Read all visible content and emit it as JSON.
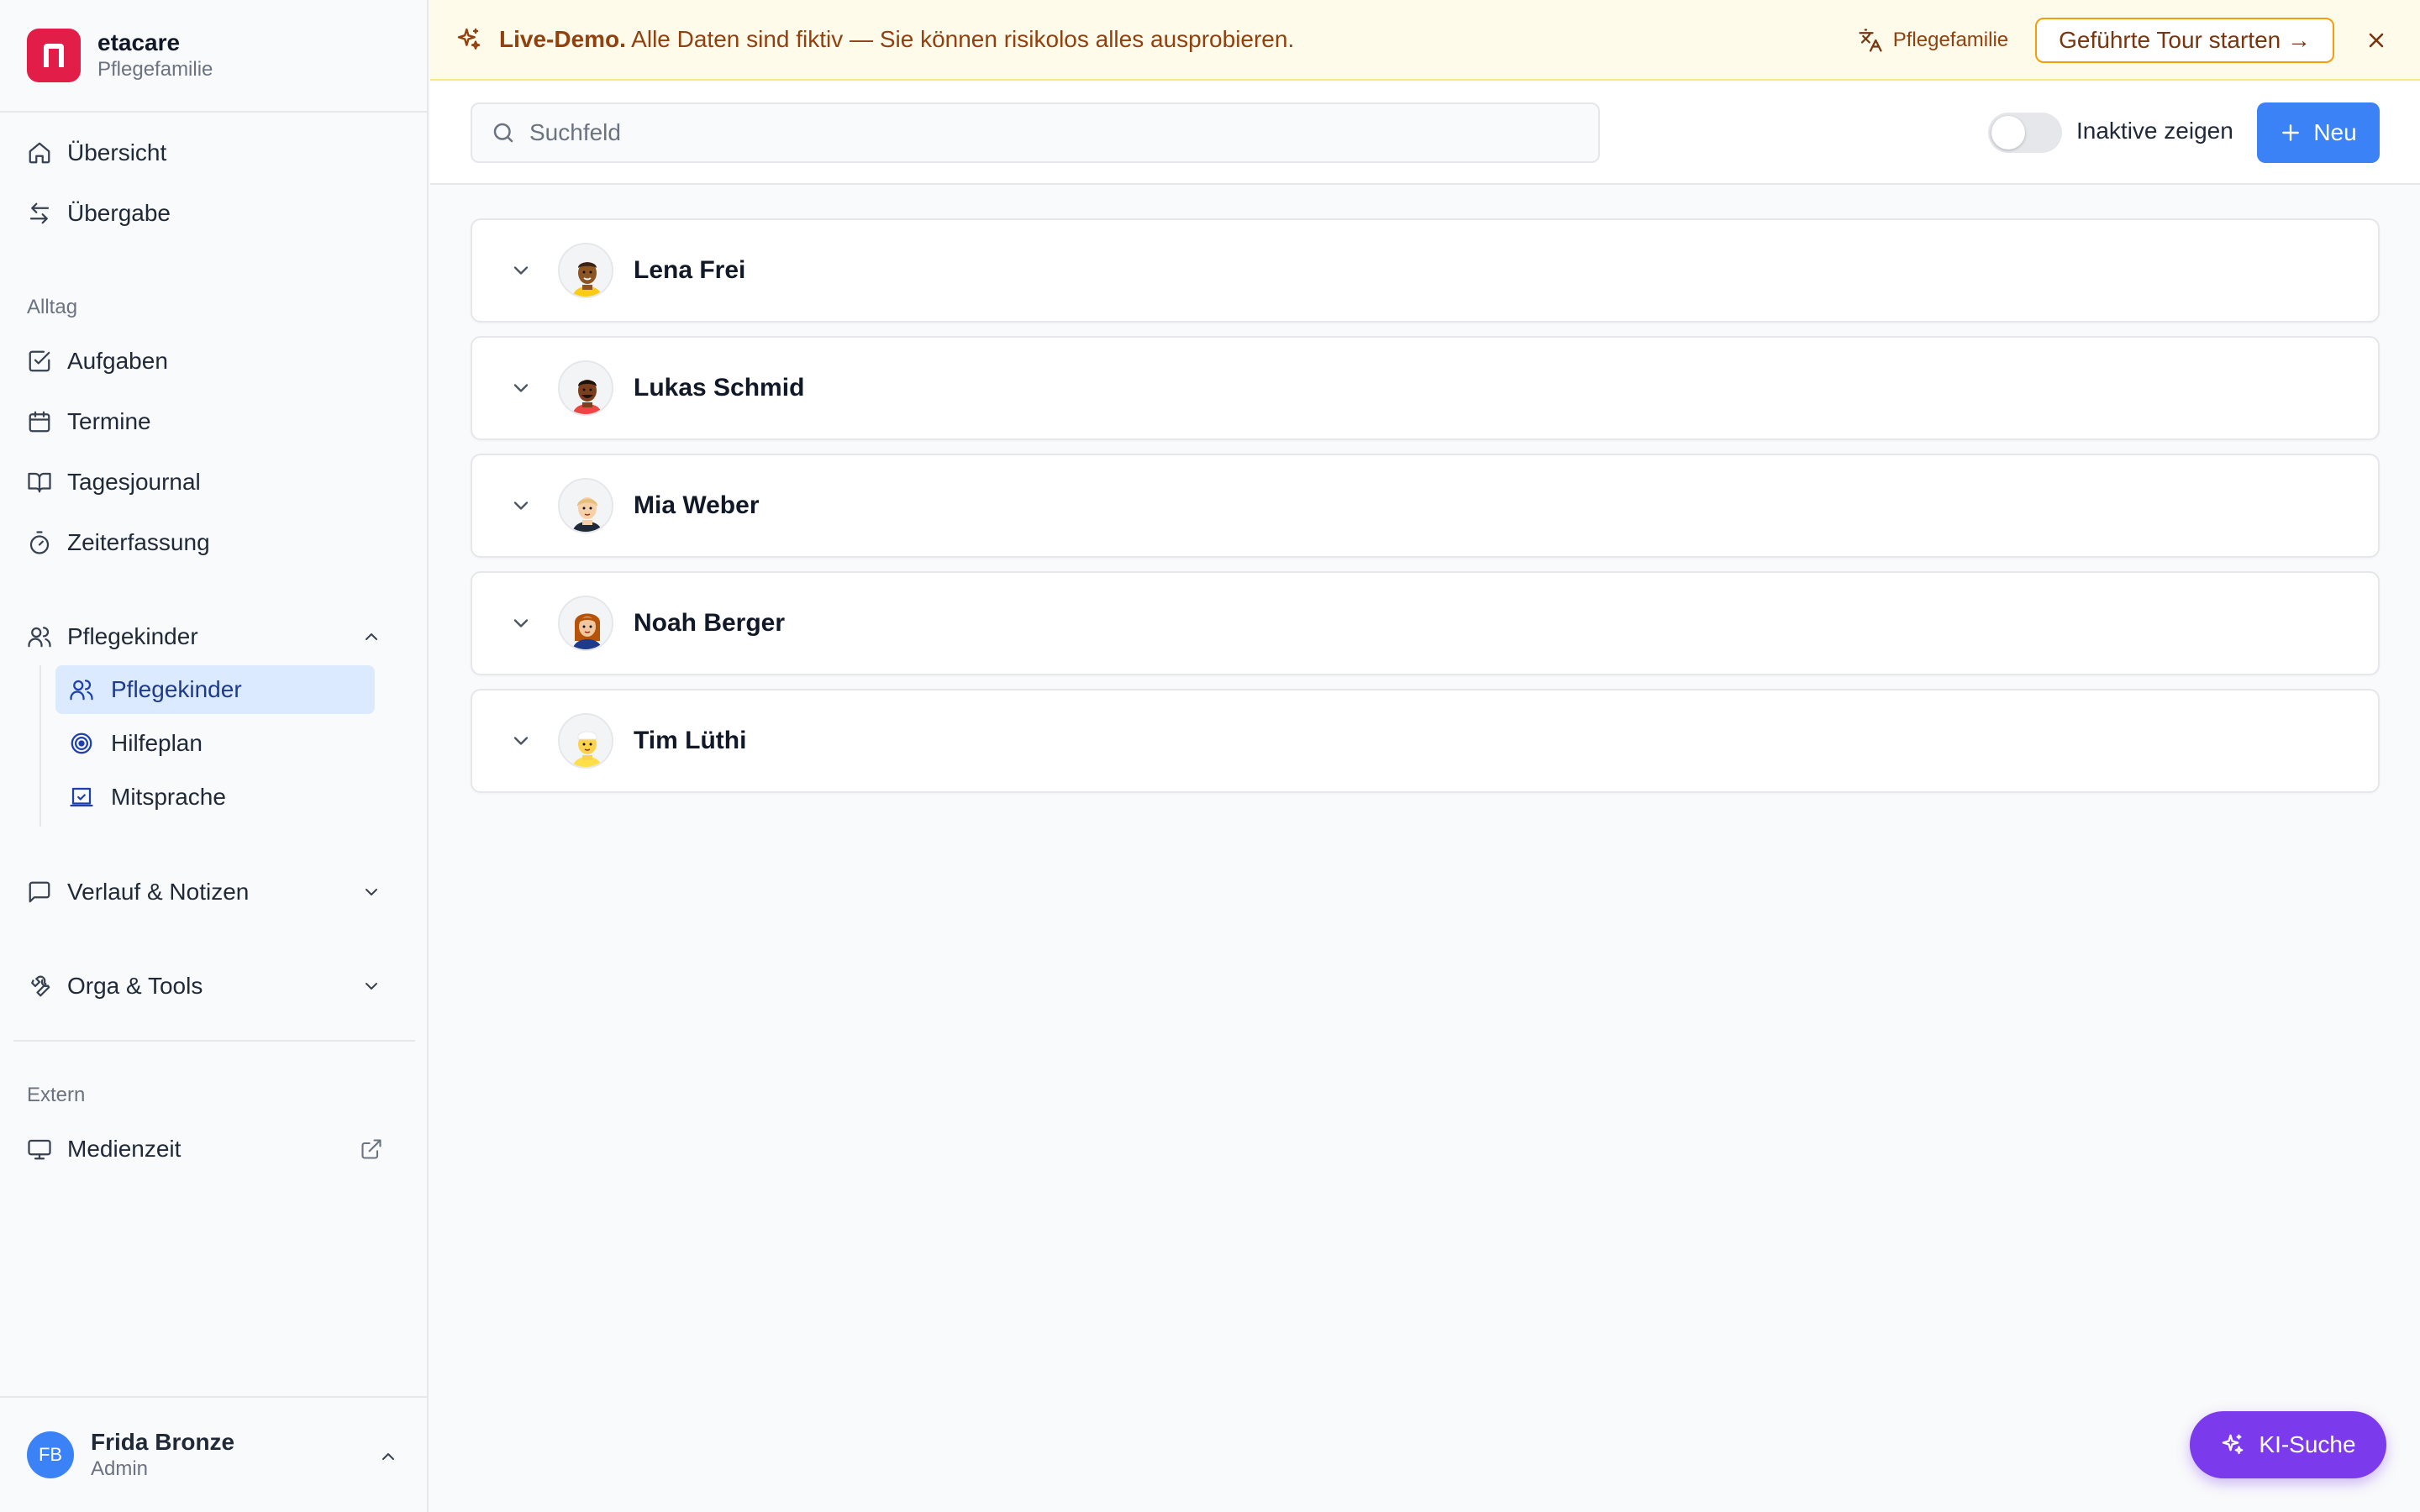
{
  "brand": {
    "name": "etacare",
    "subtitle": "Pflegefamilie",
    "logo_color": "#e11d48"
  },
  "sidebar": {
    "top_items": [
      {
        "label": "Übersicht",
        "icon": "home-icon"
      },
      {
        "label": "Übergabe",
        "icon": "arrows-swap-icon"
      }
    ],
    "section_alltag": "Alltag",
    "alltag_items": [
      {
        "label": "Aufgaben",
        "icon": "checkbox-icon"
      },
      {
        "label": "Termine",
        "icon": "calendar-icon"
      },
      {
        "label": "Tagesjournal",
        "icon": "book-icon"
      },
      {
        "label": "Zeiterfassung",
        "icon": "timer-icon"
      }
    ],
    "group_pflegekinder": {
      "label": "Pflegekinder",
      "expanded": true,
      "children": [
        {
          "label": "Pflegekinder",
          "icon": "users-icon",
          "active": true
        },
        {
          "label": "Hilfeplan",
          "icon": "target-icon",
          "active": false
        },
        {
          "label": "Mitsprache",
          "icon": "inbox-icon",
          "active": false
        }
      ]
    },
    "group_verlauf": {
      "label": "Verlauf & Notizen",
      "expanded": false
    },
    "group_orga": {
      "label": "Orga & Tools",
      "expanded": false
    },
    "section_extern": "Extern",
    "extern_items": [
      {
        "label": "Medienzeit",
        "icon": "monitor-icon"
      }
    ]
  },
  "user": {
    "initials": "FB",
    "name": "Frida Bronze",
    "role": "Admin"
  },
  "banner": {
    "bold": "Live-Demo.",
    "text": "Alle Daten sind fiktiv — Sie können risikolos alles ausprobieren.",
    "language_label": "Pflegefamilie",
    "tour_label": "Geführte Tour starten →"
  },
  "toolbar": {
    "search_placeholder": "Suchfeld",
    "search_value": "",
    "toggle_label": "Inaktive zeigen",
    "toggle_on": false,
    "new_label": "Neu"
  },
  "children": [
    {
      "name": "Lena Frei"
    },
    {
      "name": "Lukas Schmid"
    },
    {
      "name": "Mia Weber"
    },
    {
      "name": "Noah Berger"
    },
    {
      "name": "Tim Lüthi"
    }
  ],
  "ki_button": {
    "label": "KI-Suche"
  },
  "colors": {
    "accent": "#3b82f6",
    "ki": "#7c3aed",
    "banner_bg": "#fefbeb",
    "active_nav": "#dbeafe"
  }
}
